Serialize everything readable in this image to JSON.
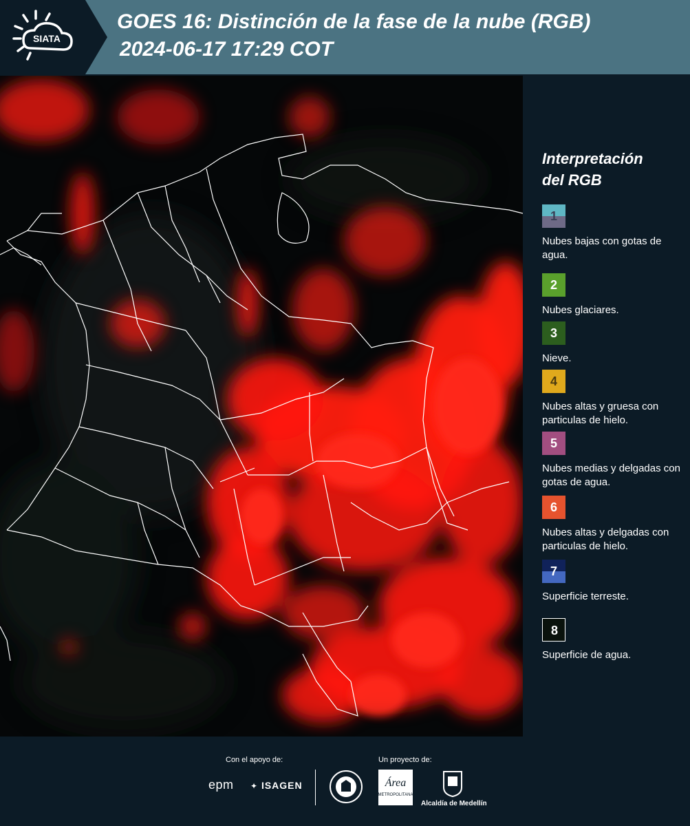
{
  "header": {
    "logo_text": "SIATA",
    "title": "GOES 16: Distinción de la fase de la nube (RGB)",
    "datetime": "2024-06-17 17:29 COT"
  },
  "legend": {
    "title_line1": "Interpretación",
    "title_line2": "del RGB",
    "items": [
      {
        "number": "1",
        "label": "Nubes bajas con gotas de agua.",
        "color_top": "#5fb7c4",
        "color_bottom": "#6e6a86",
        "num_color": "#3a3f55"
      },
      {
        "number": "2",
        "label": "Nubes glaciares.",
        "color_top": "#5aa02c",
        "color_bottom": "#5aa02c",
        "num_color": "#ffffff"
      },
      {
        "number": "3",
        "label": "Nieve.",
        "color_top": "#2c5e1e",
        "color_bottom": "#2c5e1e",
        "num_color": "#ffffff"
      },
      {
        "number": "4",
        "label": "Nubes altas y gruesa con particulas de hielo.",
        "color_top": "#e0a91c",
        "color_bottom": "#e0a91c",
        "num_color": "#4a3a10"
      },
      {
        "number": "5",
        "label": "Nubes medias y delgadas con gotas de agua.",
        "color_top": "#a24e80",
        "color_bottom": "#a24e80",
        "num_color": "#ffffff"
      },
      {
        "number": "6",
        "label": "Nubes altas y delgadas con particulas de hielo.",
        "color_top": "#e6532e",
        "color_bottom": "#e6532e",
        "num_color": "#ffffff"
      },
      {
        "number": "7",
        "label": "Superficie terreste.",
        "color_top": "#10225a",
        "color_bottom": "#4468c0",
        "num_color": "#ffffff"
      },
      {
        "number": "8",
        "label": "Superficie de agua.",
        "color_top": "#0a120c",
        "color_bottom": "#0a120c",
        "num_color": "#ffffff"
      }
    ]
  },
  "footer": {
    "support_label": "Con el apoyo de:",
    "project_label": "Un proyecto de:",
    "sponsor1": "epm",
    "sponsor2": "ISAGEN",
    "alcaldia": "Alcaldía de Medellín"
  },
  "colors": {
    "header_bg": "#4b7382",
    "page_bg": "#0c1b26",
    "cloud_red": "#ff1a10",
    "border_white": "#ffffff"
  }
}
